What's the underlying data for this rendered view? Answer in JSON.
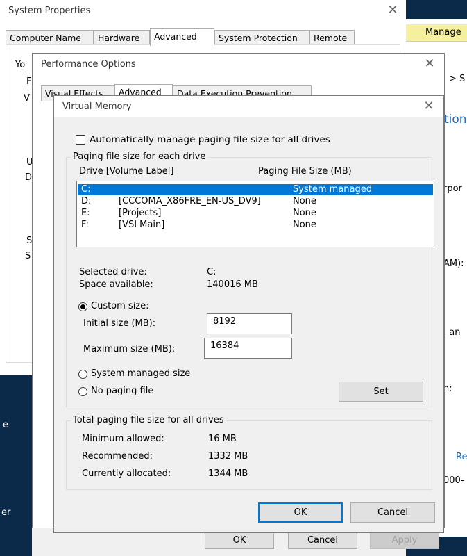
{
  "background_windows": {
    "right_fragments": [
      "Manage",
      "> S",
      "tion",
      "rpor",
      "AM):",
      ", an",
      "n:",
      "Re",
      "000-"
    ],
    "left_fragments": [
      "Yo",
      "F",
      "V",
      "U",
      "D",
      "S",
      "S",
      "e",
      "er"
    ]
  },
  "system_properties": {
    "title": "System Properties",
    "tabs": [
      "Computer Name",
      "Hardware",
      "Advanced",
      "System Protection",
      "Remote"
    ],
    "selected_tab": "Advanced",
    "buttons": {
      "ok": "OK",
      "cancel": "Cancel",
      "apply": "Apply"
    }
  },
  "performance_options": {
    "title": "Performance Options",
    "tabs": [
      "Visual Effects",
      "Advanced",
      "Data Execution Prevention"
    ],
    "selected_tab": "Advanced"
  },
  "virtual_memory": {
    "title": "Virtual Memory",
    "auto_manage_label": "Automatically manage paging file size for all drives",
    "auto_manage_checked": false,
    "per_drive_group_label": "Paging file size for each drive",
    "column_drive": "Drive  [Volume Label]",
    "column_size": "Paging File Size (MB)",
    "drives": [
      {
        "drive": "C:",
        "label": "",
        "size": "System managed",
        "selected": true
      },
      {
        "drive": "D:",
        "label": "[CCCOMA_X86FRE_EN-US_DV9]",
        "size": "None",
        "selected": false
      },
      {
        "drive": "E:",
        "label": "[Projects]",
        "size": "None",
        "selected": false
      },
      {
        "drive": "F:",
        "label": "[VSI Main]",
        "size": "None",
        "selected": false
      }
    ],
    "selected_drive_label": "Selected drive:",
    "selected_drive_value": "C:",
    "space_available_label": "Space available:",
    "space_available_value": "140016 MB",
    "custom_size_label": "Custom size:",
    "initial_size_label": "Initial size (MB):",
    "initial_size_value": "8192",
    "maximum_size_label": "Maximum size (MB):",
    "maximum_size_value": "16384",
    "system_managed_label": "System managed size",
    "no_paging_label": "No paging file",
    "selected_option": "custom",
    "set_button": "Set",
    "total_group_label": "Total paging file size for all drives",
    "minimum_allowed_label": "Minimum allowed:",
    "minimum_allowed_value": "16 MB",
    "recommended_label": "Recommended:",
    "recommended_value": "1332 MB",
    "currently_allocated_label": "Currently allocated:",
    "currently_allocated_value": "1344 MB",
    "ok_button": "OK",
    "cancel_button": "Cancel"
  },
  "colors": {
    "selection": "#0078d7",
    "manage_tab": "#f5f0a0"
  }
}
